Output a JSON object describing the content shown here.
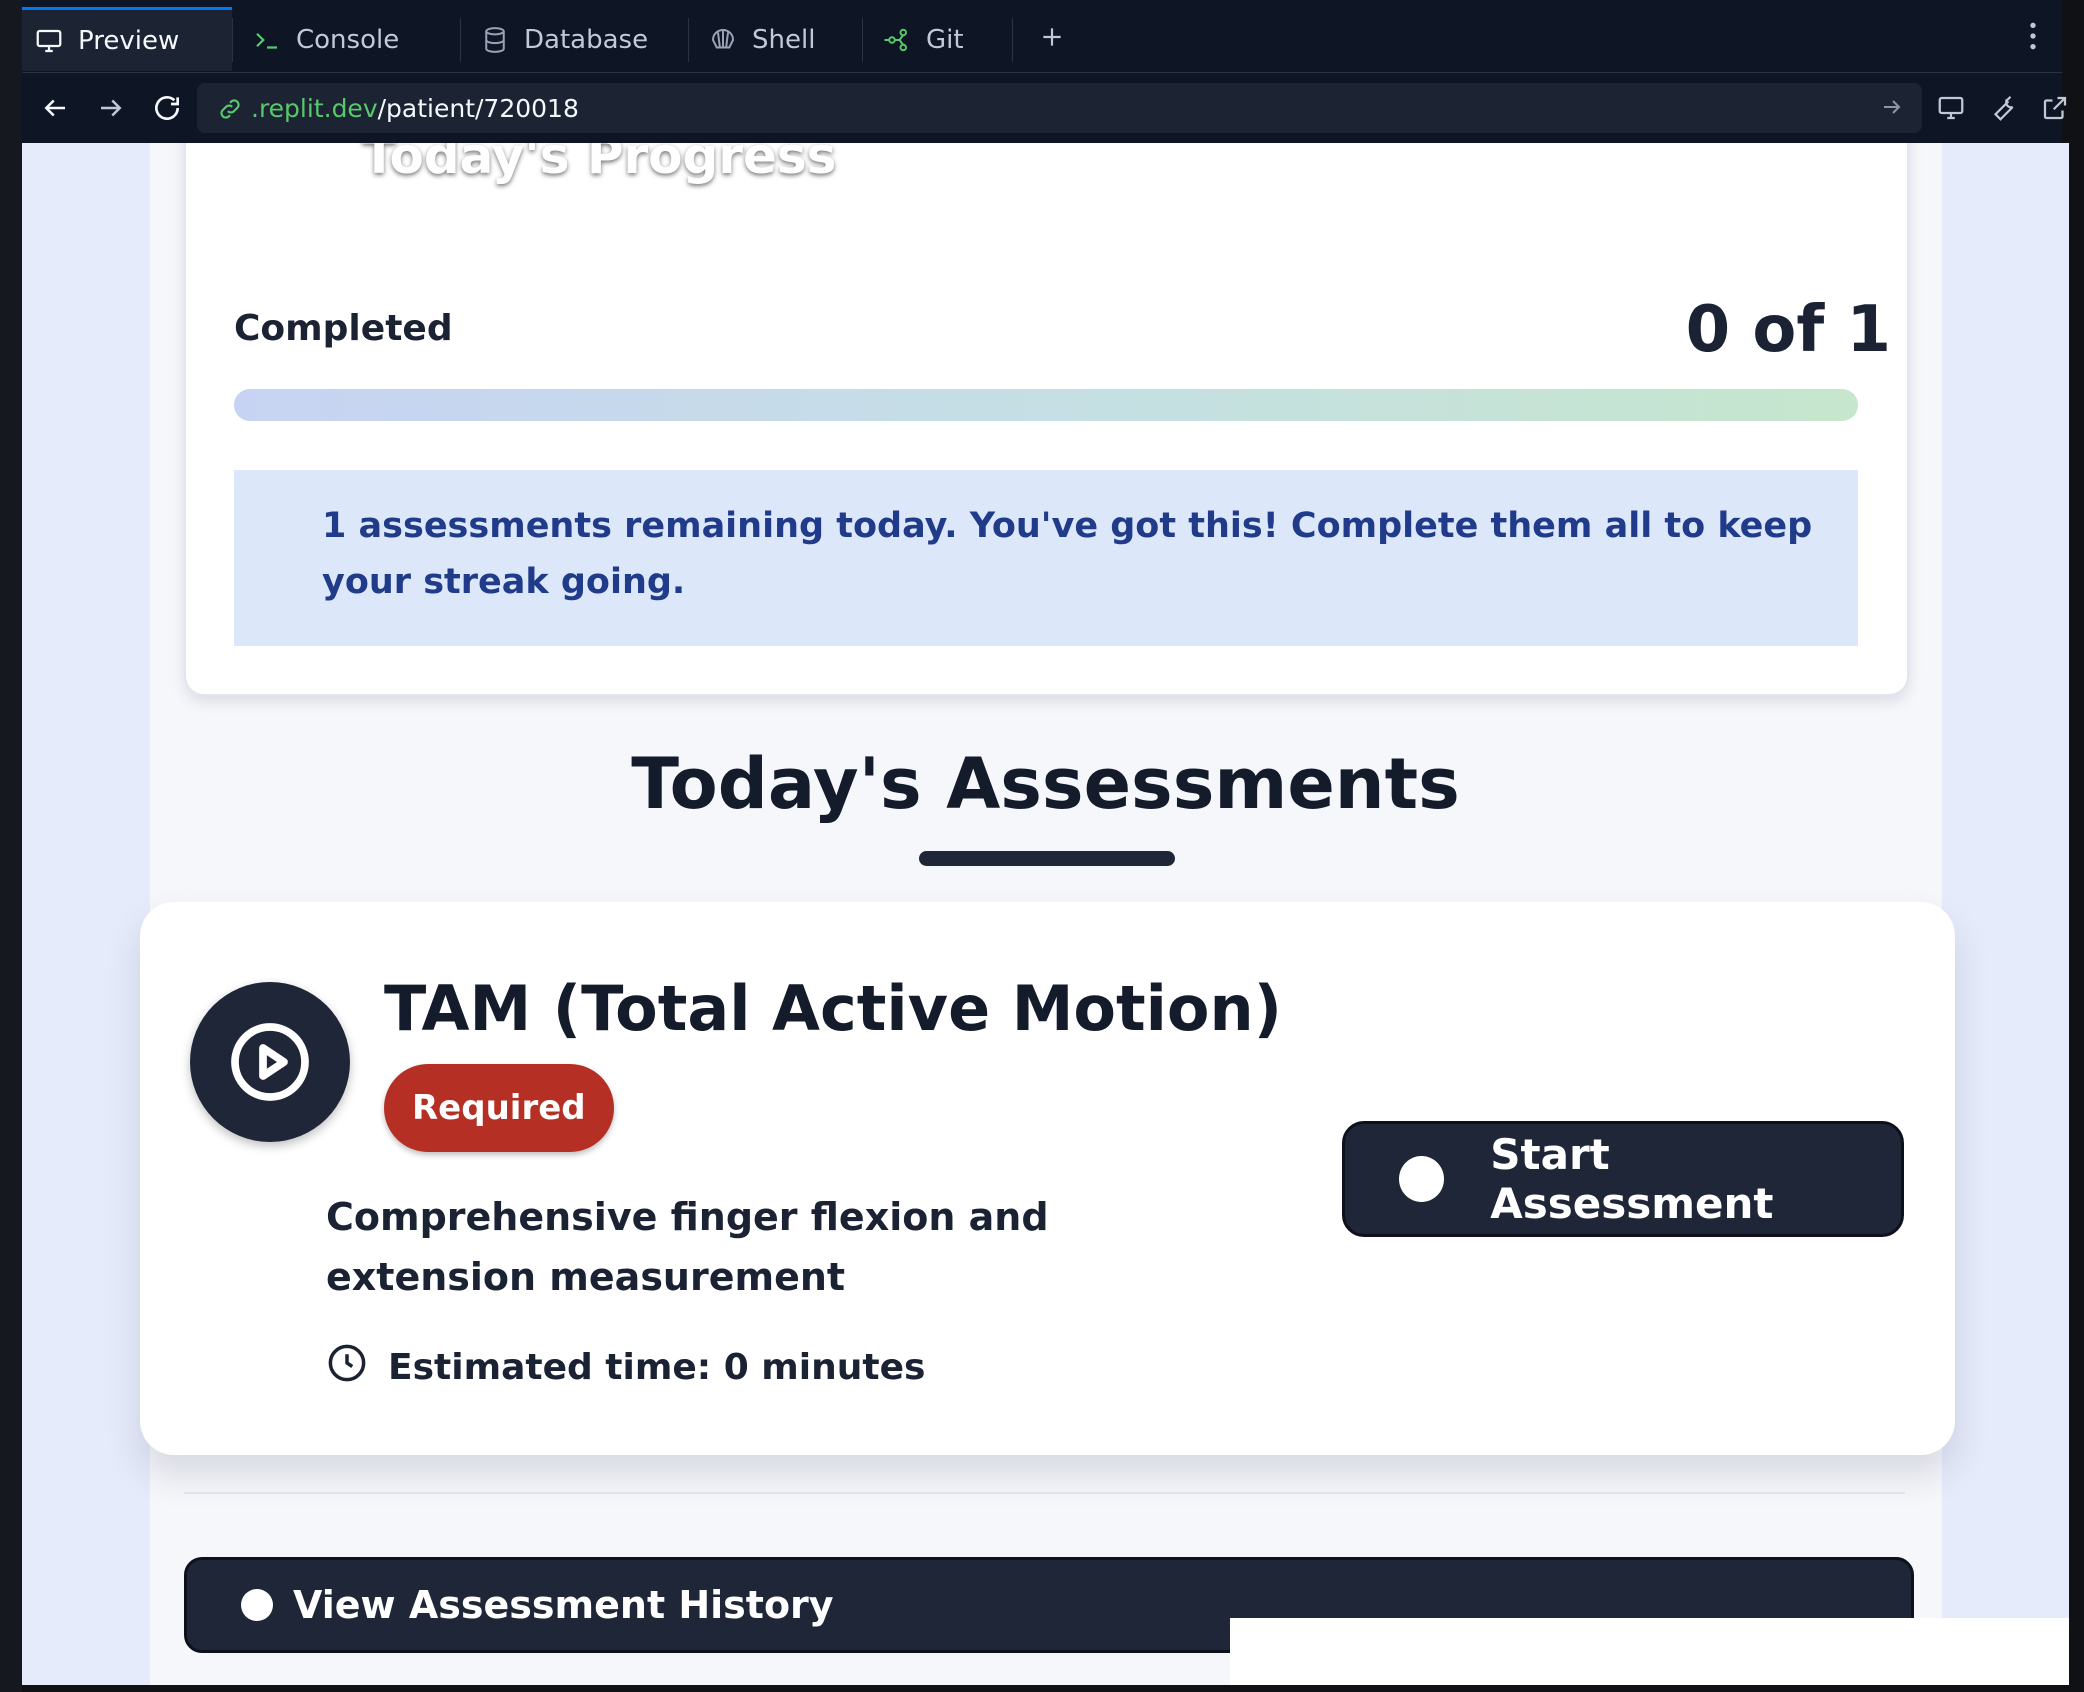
{
  "tabs": [
    {
      "label": "Preview",
      "icon": "monitor-icon"
    },
    {
      "label": "Console",
      "icon": "terminal-icon"
    },
    {
      "label": "Database",
      "icon": "database-icon"
    },
    {
      "label": "Shell",
      "icon": "shell-icon"
    },
    {
      "label": "Git",
      "icon": "git-icon"
    }
  ],
  "address": {
    "domain": ".replit.dev",
    "path": "/patient/720018"
  },
  "progress": {
    "title": "Today's Progress",
    "completed_label": "Completed",
    "completed_value": "0 of 1",
    "fraction": 0,
    "message": "1 assessments remaining today. You've got this! Complete them all to keep your streak going."
  },
  "assessments": {
    "section_title": "Today's Assessments",
    "items": [
      {
        "title": "TAM (Total Active Motion)",
        "badge": "Required",
        "description": "Comprehensive finger flexion and extension measurement",
        "estimated_time": "Estimated time: 0 minutes",
        "button_label": "Start Assessment"
      }
    ]
  },
  "history": {
    "button_label": "View Assessment History"
  },
  "colors": {
    "accent_tab": "#0079f2",
    "domain_green": "#58c96b",
    "primary_dark": "#1e2637",
    "required_red": "#b52f24",
    "info_bg": "#dde7fa",
    "info_text": "#1f3b8a"
  }
}
